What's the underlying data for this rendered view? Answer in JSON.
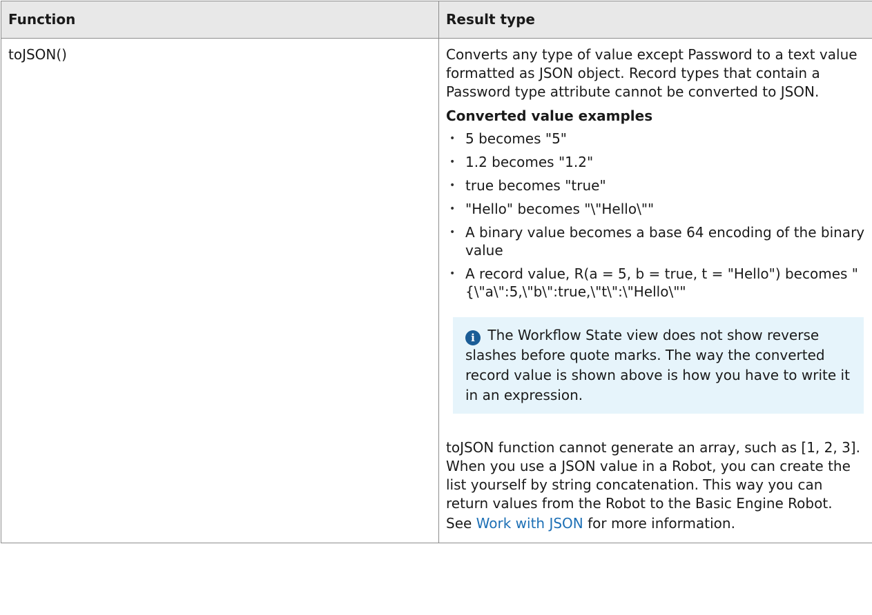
{
  "table": {
    "headers": [
      "Function",
      "Result type"
    ],
    "row": {
      "function": "toJSON()",
      "description": "Converts any type of value except Password to a text value formatted as JSON object. Record types that contain a Password type attribute cannot be converted to JSON.",
      "examples_heading": "Converted value examples",
      "examples": [
        "5 becomes \"5\"",
        "1.2 becomes \"1.2\"",
        "true becomes \"true\"",
        "\"Hello\" becomes \"\\\"Hello\\\"\"",
        "A binary value becomes a base 64 encoding of the binary value",
        "A record value, R(a = 5, b = true, t = \"Hello\") becomes \"{\\\"a\\\":5,\\\"b\\\":true,\\\"t\\\":\\\"Hello\\\"\""
      ],
      "note_icon": "info-icon",
      "note_text": "The Workflow State view does not show reverse slashes before quote marks. The way the converted record value is shown above is how you have to write it in an expression.",
      "array_paragraph": "toJSON function cannot generate an array, such as [1, 2, 3]. When you use a JSON value in a Robot, you can create the list yourself by string concatenation. This way you can return values from the Robot to the Basic Engine Robot.",
      "see_prefix": "See ",
      "see_link": "Work with JSON",
      "see_suffix": " for more information."
    }
  },
  "colors": {
    "header_bg": "#e8e8e8",
    "note_bg": "#e6f4fb",
    "link": "#1c6fb5",
    "info_icon": "#1a5c96"
  }
}
